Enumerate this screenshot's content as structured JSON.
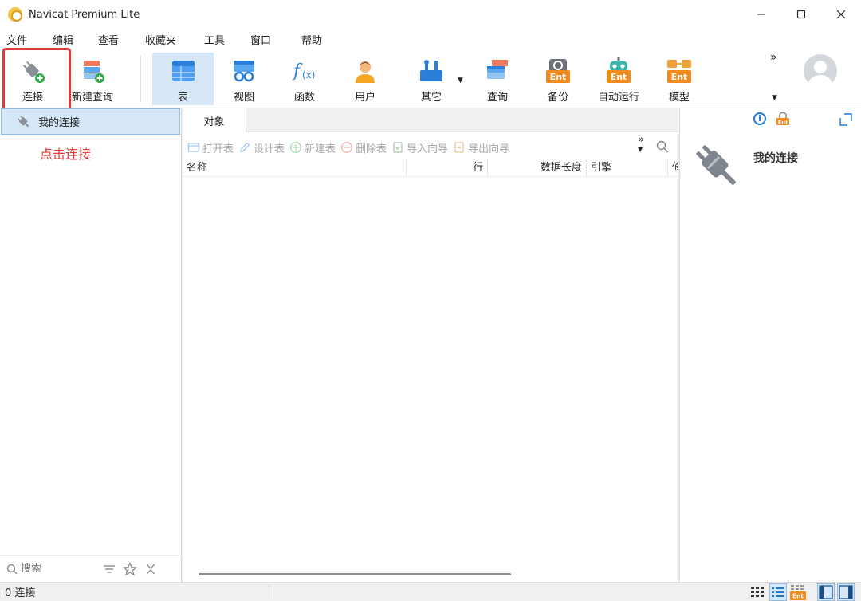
{
  "window": {
    "title": "Navicat Premium Lite",
    "controls": [
      "minimize",
      "maximize",
      "close"
    ]
  },
  "menu": [
    "文件",
    "编辑",
    "查看",
    "收藏夹",
    "工具",
    "窗口",
    "帮助"
  ],
  "toolbar": {
    "items": [
      {
        "label": "连接",
        "icon": "connection-plug-icon"
      },
      {
        "label": "新建查询",
        "icon": "new-query-icon"
      },
      {
        "label": "表",
        "icon": "table-icon",
        "active": true
      },
      {
        "label": "视图",
        "icon": "view-icon"
      },
      {
        "label": "函数",
        "icon": "function-icon"
      },
      {
        "label": "用户",
        "icon": "user-icon"
      },
      {
        "label": "其它",
        "icon": "others-icon"
      },
      {
        "label": "查询",
        "icon": "query-icon"
      },
      {
        "label": "备份",
        "icon": "backup-ent-icon"
      },
      {
        "label": "自动运行",
        "icon": "automation-ent-icon"
      },
      {
        "label": "模型",
        "icon": "model-ent-icon"
      }
    ],
    "more": "»"
  },
  "left": {
    "connection": "我的连接",
    "annotation": "点击连接",
    "search_placeholder": "搜索"
  },
  "center": {
    "tab": "对象",
    "actions": [
      "打开表",
      "设计表",
      "新建表",
      "删除表",
      "导入向导",
      "导出向导"
    ],
    "more": "»",
    "columns": [
      "名称",
      "行",
      "数据长度",
      "引擎",
      "修"
    ]
  },
  "right": {
    "title": "我的连接"
  },
  "status": {
    "text": "0 连接"
  },
  "colors": {
    "accent_blue": "#1e78d6",
    "selection": "#d6e8f8",
    "annotation_red": "#e53935",
    "ent_orange": "#f08a1c"
  }
}
